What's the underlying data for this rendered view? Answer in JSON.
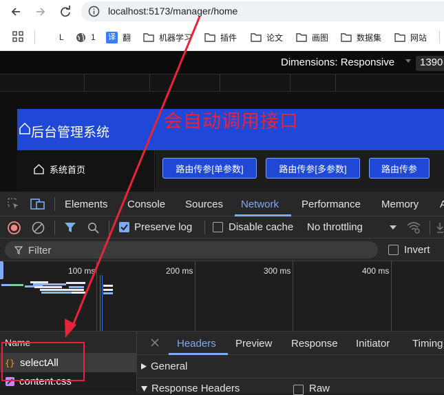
{
  "browser": {
    "url": "localhost:5173/manager/home",
    "bookmarks": [
      {
        "label": "L",
        "icon": "page-icon"
      },
      {
        "label": "1",
        "icon": "globe-icon"
      },
      {
        "label": "翻",
        "icon": "translate-icon",
        "badge": "译"
      },
      {
        "label": "机器学习",
        "icon": "folder-icon"
      },
      {
        "label": "插件",
        "icon": "folder-icon"
      },
      {
        "label": "论文",
        "icon": "folder-icon"
      },
      {
        "label": "画图",
        "icon": "folder-icon"
      },
      {
        "label": "数据集",
        "icon": "folder-icon"
      },
      {
        "label": "网站",
        "icon": "folder-icon"
      }
    ]
  },
  "device_toolbar": {
    "dimensions_label": "Dimensions: Responsive",
    "width_value": "1390"
  },
  "app": {
    "title": "后台管理系统",
    "sidebar_item": "系统首页",
    "buttons": [
      "路由传参[单参数]",
      "路由传参[多参数]",
      "路由传参"
    ],
    "header_color": "#1f48d6"
  },
  "annotation": {
    "text": "会自动调用接口",
    "color": "#e8243a"
  },
  "devtools": {
    "tabs": [
      "Elements",
      "Console",
      "Sources",
      "Network",
      "Performance",
      "Memory",
      "A"
    ],
    "active_tab": "Network",
    "toolbar": {
      "preserve_log": "Preserve log",
      "disable_cache": "Disable cache",
      "throttling": "No throttling"
    },
    "filter_placeholder": "Filter",
    "invert_label": "Invert",
    "timeline_labels": [
      "100 ms",
      "200 ms",
      "300 ms",
      "400 ms"
    ],
    "name_column": "Name",
    "requests": [
      {
        "name": "selectAll",
        "icon": "xhr-icon"
      },
      {
        "name": "content.css",
        "icon": "css-icon"
      }
    ],
    "detail_tabs": [
      "Headers",
      "Preview",
      "Response",
      "Initiator",
      "Timing"
    ],
    "active_detail_tab": "Headers",
    "sections": {
      "general": "General",
      "response_headers": "Response Headers",
      "raw": "Raw"
    },
    "accent_color": "#7cacf8"
  }
}
